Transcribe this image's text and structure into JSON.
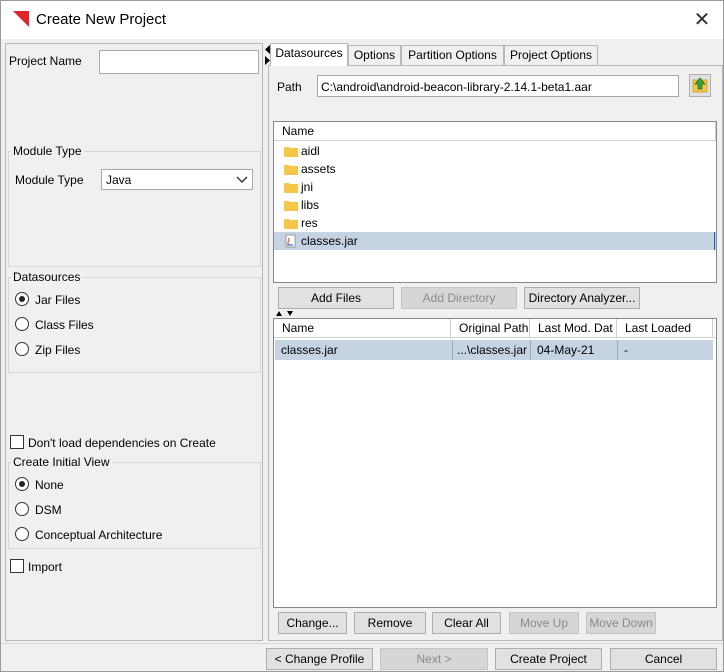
{
  "window": {
    "title": "Create New Project",
    "logo_color": "#e0242b"
  },
  "left": {
    "project_name_label": "Project Name",
    "project_name_value": "",
    "module_group_title": "Module Type",
    "module_type_label": "Module Type",
    "module_type_value": "Java",
    "datasources_group_title": "Datasources",
    "datasource_options": [
      {
        "label": "Jar Files",
        "selected": true
      },
      {
        "label": "Class Files",
        "selected": false
      },
      {
        "label": "Zip Files",
        "selected": false
      }
    ],
    "dont_load_label": "Don't load dependencies on Create",
    "initial_view_group_title": "Create Initial View",
    "initial_view_options": [
      {
        "label": "None",
        "selected": true
      },
      {
        "label": "DSM",
        "selected": false
      },
      {
        "label": "Conceptual Architecture",
        "selected": false
      }
    ],
    "import_label": "Import"
  },
  "tabs": [
    {
      "label": "Datasources",
      "active": true
    },
    {
      "label": "Options",
      "active": false
    },
    {
      "label": "Partition Options",
      "active": false
    },
    {
      "label": "Project Options",
      "active": false
    }
  ],
  "datasources": {
    "path_label": "Path",
    "path_value": "C:\\android\\android-beacon-library-2.14.1-beta1.aar",
    "browser_header": "Name",
    "browser_items": [
      {
        "name": "aidl",
        "type": "folder",
        "selected": false
      },
      {
        "name": "assets",
        "type": "folder",
        "selected": false
      },
      {
        "name": "jni",
        "type": "folder",
        "selected": false
      },
      {
        "name": "libs",
        "type": "folder",
        "selected": false
      },
      {
        "name": "res",
        "type": "folder",
        "selected": false
      },
      {
        "name": "classes.jar",
        "type": "jar",
        "selected": true
      }
    ],
    "add_files": "Add Files",
    "add_directory": "Add Directory",
    "directory_analyzer": "Directory Analyzer...",
    "table_headers": [
      "Name",
      "Original Path",
      "Last Mod. Dat",
      "Last Loaded"
    ],
    "table_rows": [
      [
        "classes.jar",
        "...\\classes.jar",
        "04-May-21",
        "-"
      ]
    ],
    "change": "Change...",
    "remove": "Remove",
    "clear_all": "Clear All",
    "move_up": "Move Up",
    "move_down": "Move Down"
  },
  "footer": {
    "change_profile": "< Change Profile",
    "next": "Next >",
    "create_project": "Create Project",
    "cancel": "Cancel"
  },
  "colors": {
    "selection": "#c5d3e3",
    "folder": "#f4c64a",
    "up_icon": "#3aa23a"
  }
}
